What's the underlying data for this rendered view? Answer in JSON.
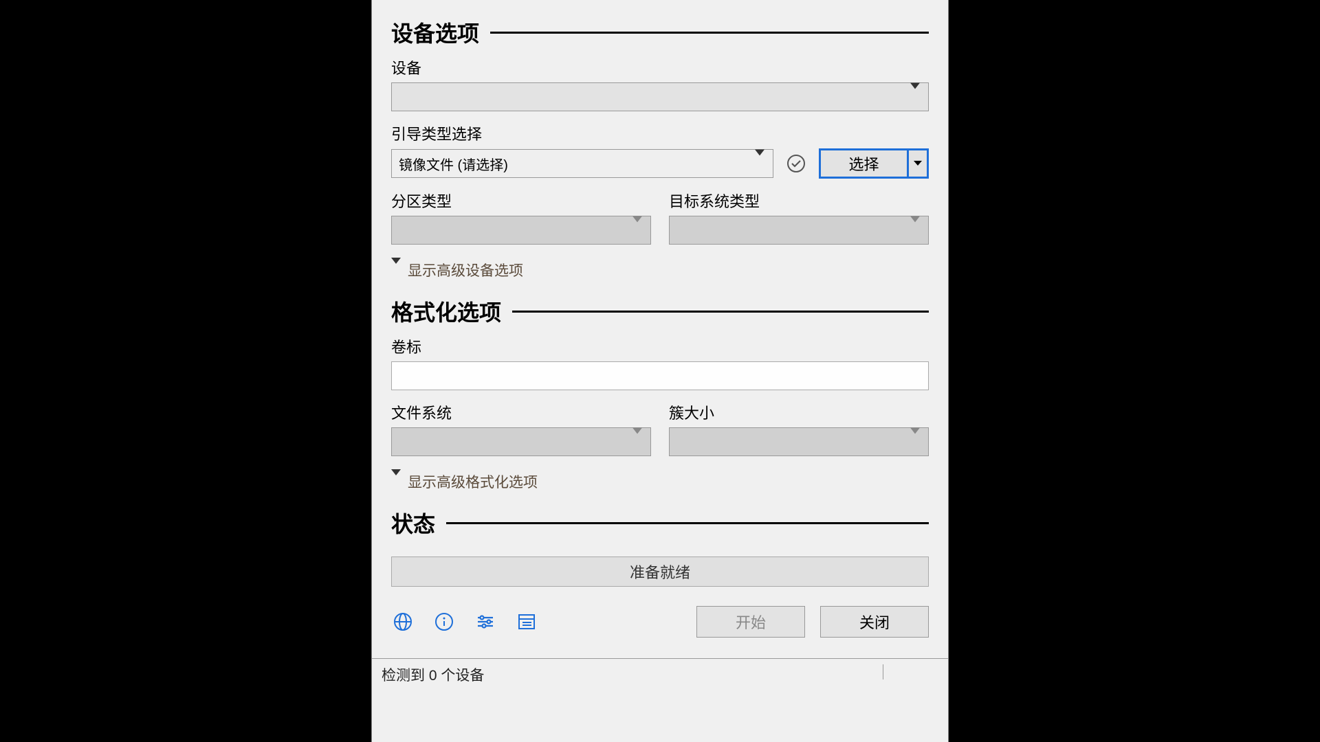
{
  "sections": {
    "device": {
      "title": "设备选项",
      "device_label": "设备",
      "device_value": "",
      "boot_type_label": "引导类型选择",
      "boot_type_value": "镜像文件 (请选择)",
      "select_button": "选择",
      "partition_label": "分区类型",
      "partition_value": "",
      "target_system_label": "目标系统类型",
      "target_system_value": "",
      "show_advanced": "显示高级设备选项"
    },
    "format": {
      "title": "格式化选项",
      "volume_label": "卷标",
      "volume_value": "",
      "filesystem_label": "文件系统",
      "filesystem_value": "",
      "cluster_label": "簇大小",
      "cluster_value": "",
      "show_advanced": "显示高级格式化选项"
    },
    "status": {
      "title": "状态",
      "ready": "准备就绪"
    }
  },
  "buttons": {
    "start": "开始",
    "close": "关闭"
  },
  "footer": {
    "device_count": "检测到 0 个设备"
  }
}
